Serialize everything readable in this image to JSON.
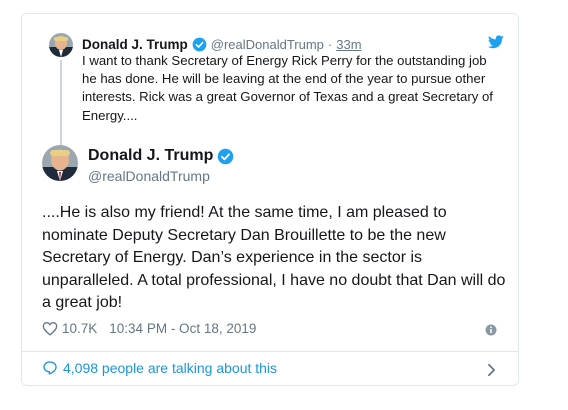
{
  "parent_tweet": {
    "name": "Donald J. Trump",
    "handle": "@realDonaldTrump",
    "separator": "·",
    "time": "33m",
    "text": "I want to thank Secretary of Energy Rick Perry for the outstanding job he has done. He will be leaving at the end of the year to pursue other interests. Rick was a great Governor of Texas and a great Secretary of Energy...."
  },
  "main_tweet": {
    "name": "Donald J. Trump",
    "handle": "@realDonaldTrump",
    "text": "....He is also my friend! At the same time, I am pleased to nominate Deputy Secretary Dan Brouillette to be the new Secretary of Energy. Dan’s experience in the sector is unparalleled. A total professional, I have no doubt that Dan will do a great job!",
    "likes": "10.7K",
    "timestamp": "10:34 PM - Oct 18, 2019"
  },
  "footer": {
    "talking_text": "4,098 people are talking about this"
  },
  "icons": {
    "verified": "verified-badge-icon",
    "bird": "twitter-bird-icon",
    "heart": "heart-icon",
    "info": "info-icon",
    "bubble": "speech-bubble-icon",
    "chevron": "chevron-right-icon"
  },
  "colors": {
    "accent": "#1da1f2",
    "link": "#1b95e0",
    "muted": "#657786",
    "text": "#14171a",
    "border": "#e1e8ed"
  }
}
